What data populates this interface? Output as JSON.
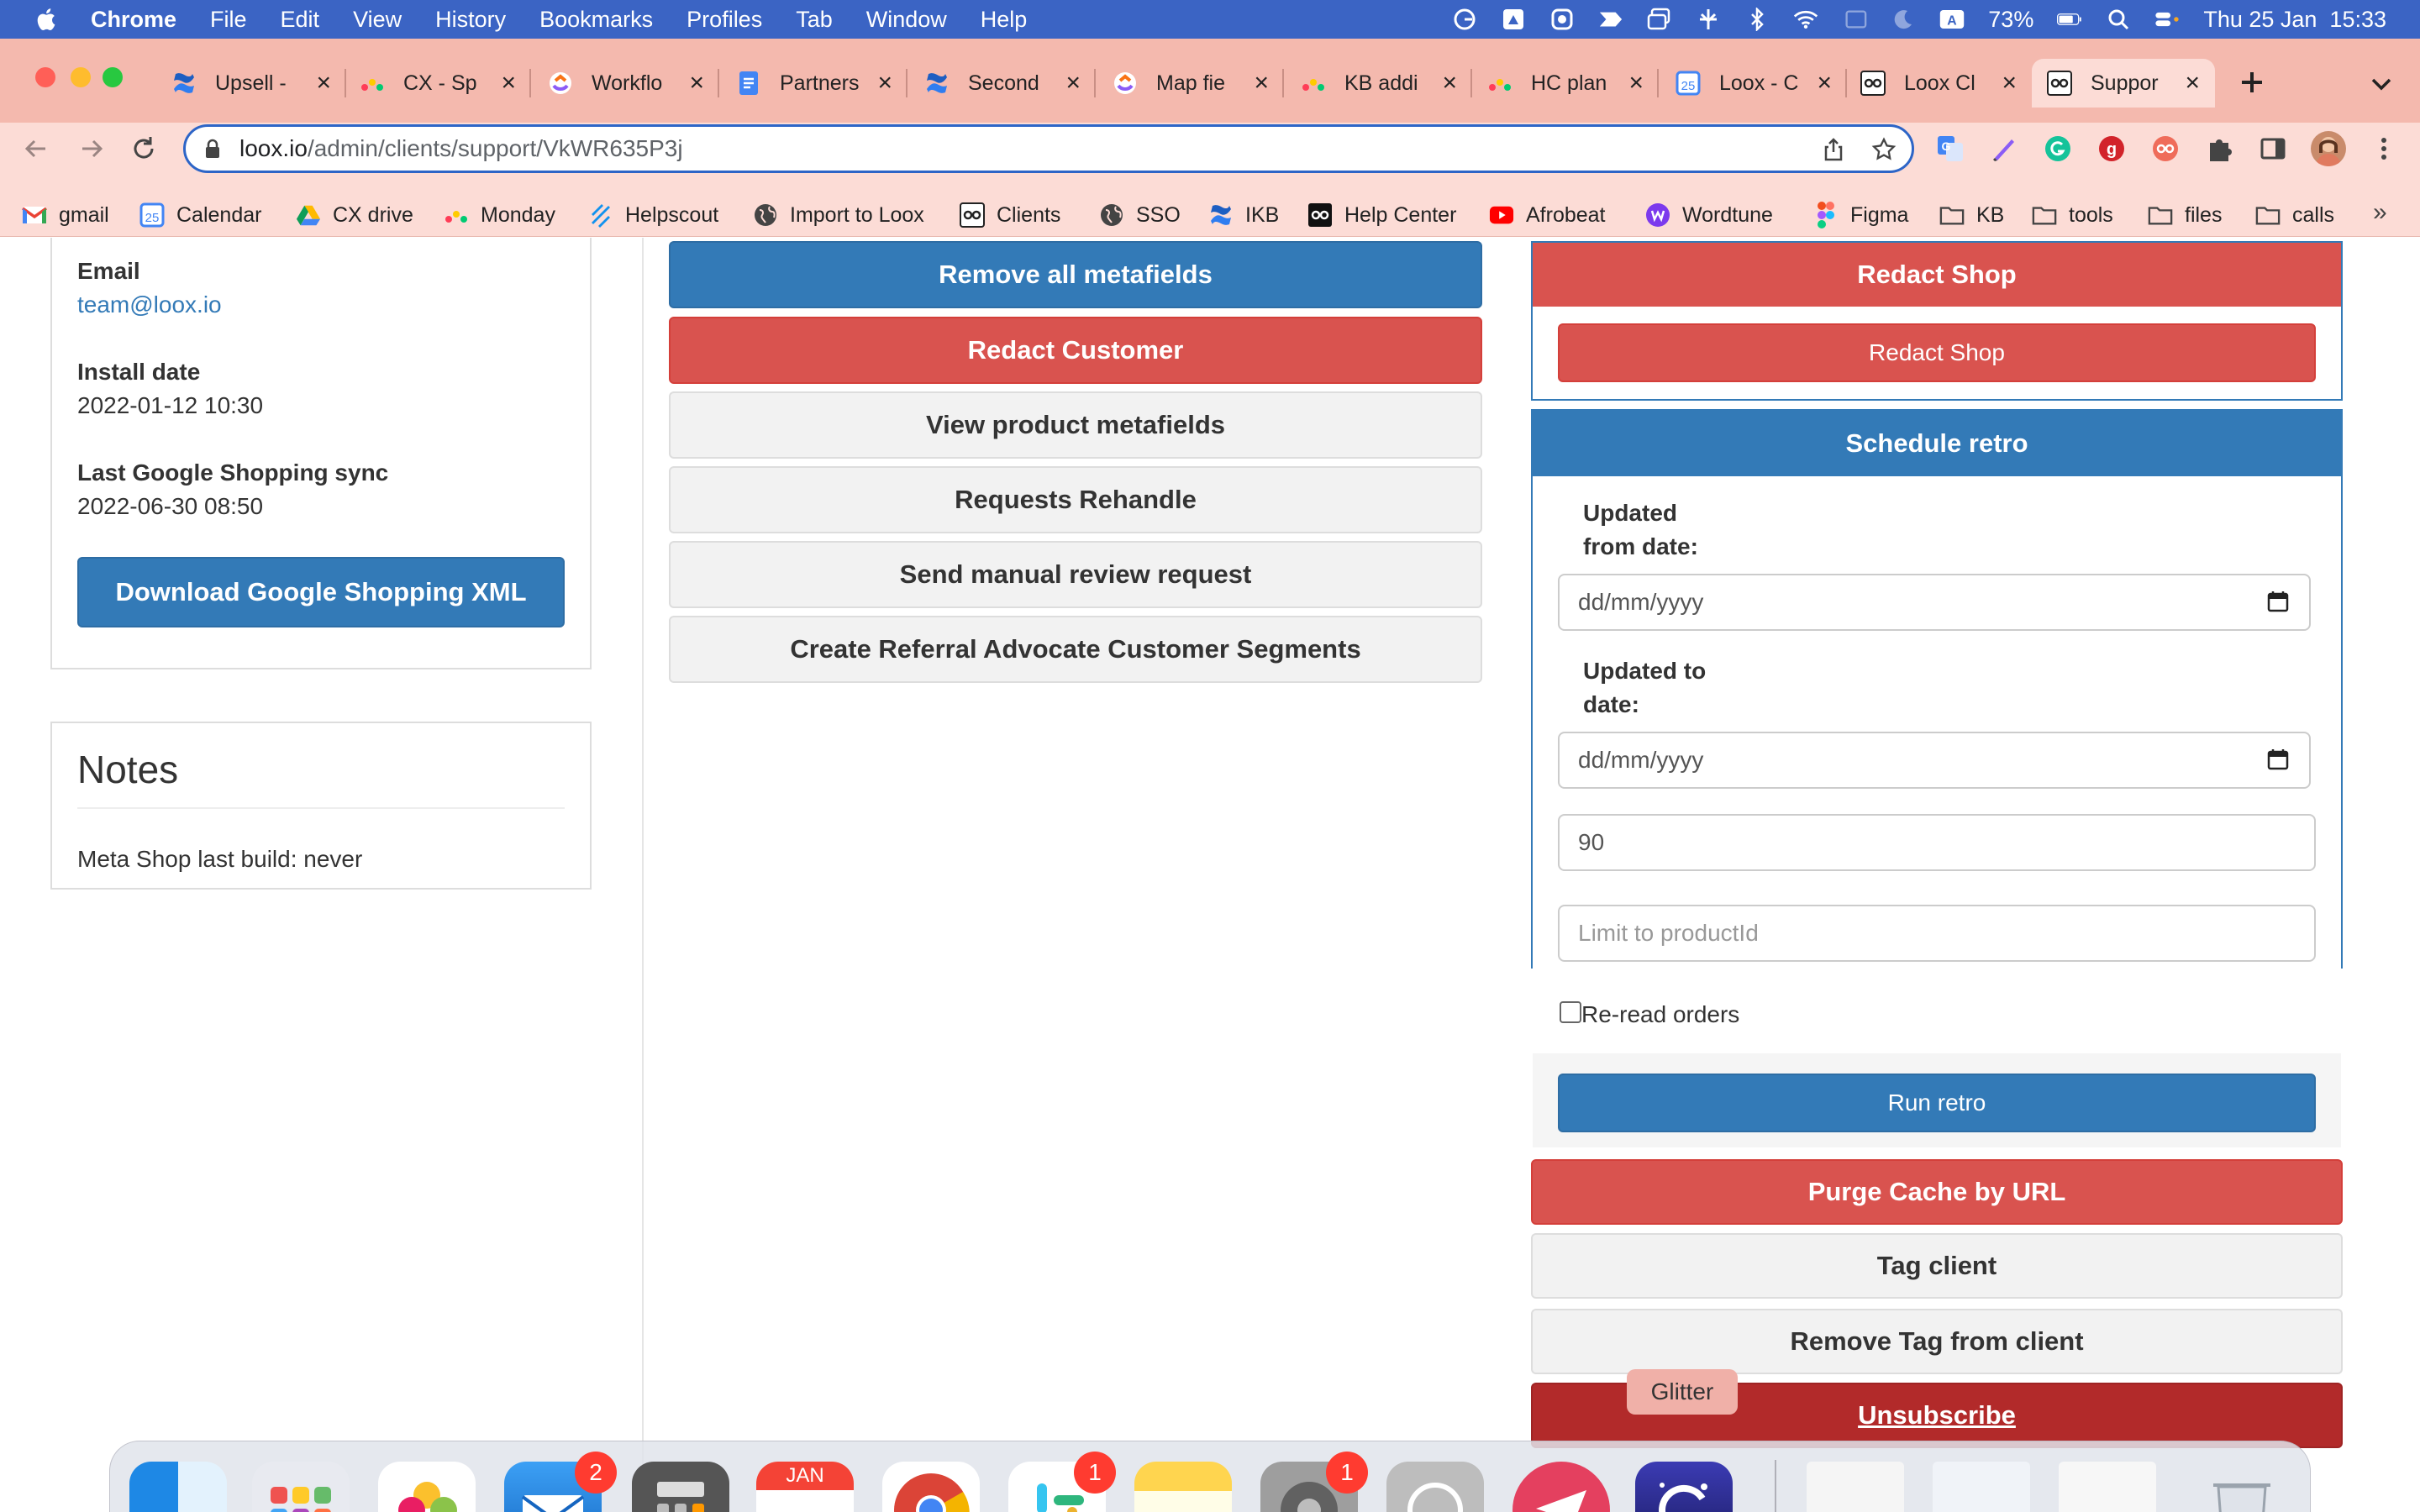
{
  "menubar": {
    "app": "Chrome",
    "items": [
      "File",
      "Edit",
      "View",
      "History",
      "Bookmarks",
      "Profiles",
      "Tab",
      "Window",
      "Help"
    ],
    "battery": "73%",
    "clock": "Thu 25 Jan  15:33"
  },
  "tabs": [
    {
      "title": "Upsell -",
      "icon": "confluence-icon"
    },
    {
      "title": "CX - Sp",
      "icon": "monday-icon"
    },
    {
      "title": "Workflo",
      "icon": "clickup-icon"
    },
    {
      "title": "Partners",
      "icon": "docs-icon"
    },
    {
      "title": "Second",
      "icon": "confluence-icon"
    },
    {
      "title": "Map fie",
      "icon": "clickup-icon"
    },
    {
      "title": "KB addi",
      "icon": "monday-icon"
    },
    {
      "title": "HC plan",
      "icon": "monday-icon"
    },
    {
      "title": "Loox - C",
      "icon": "calendar-icon"
    },
    {
      "title": "Loox Cl",
      "icon": "loox-icon"
    },
    {
      "title": "Suppor",
      "icon": "loox-icon",
      "active": true
    }
  ],
  "address": {
    "host": "loox.io",
    "path": "/admin/clients/support/VkWR635P3j"
  },
  "bookmarks": [
    {
      "label": "gmail",
      "icon": "gmail-icon"
    },
    {
      "label": "Calendar",
      "icon": "calendar-icon"
    },
    {
      "label": "CX drive",
      "icon": "drive-icon"
    },
    {
      "label": "Monday",
      "icon": "monday-icon"
    },
    {
      "label": "Helpscout",
      "icon": "helpscout-icon"
    },
    {
      "label": "Import to Loox",
      "icon": "globe-icon"
    },
    {
      "label": "Clients",
      "icon": "loox-icon"
    },
    {
      "label": "SSO",
      "icon": "globe-icon"
    },
    {
      "label": "IKB",
      "icon": "confluence-icon"
    },
    {
      "label": "Help Center",
      "icon": "loox-icon"
    },
    {
      "label": "Afrobeat",
      "icon": "youtube-icon"
    },
    {
      "label": "Wordtune",
      "icon": "wordtune-icon"
    },
    {
      "label": "Figma",
      "icon": "figma-icon"
    },
    {
      "label": "KB",
      "icon": "folder-icon"
    },
    {
      "label": "tools",
      "icon": "folder-icon"
    },
    {
      "label": "files",
      "icon": "folder-icon"
    },
    {
      "label": "calls",
      "icon": "folder-icon"
    }
  ],
  "info": {
    "email_label": "Email",
    "email_value": "team@loox.io",
    "install_label": "Install date",
    "install_value": "2022-01-12 10:30",
    "sync_label": "Last Google Shopping sync",
    "sync_value": "2022-06-30 08:50",
    "download_button": "Download Google Shopping XML"
  },
  "notes": {
    "title": "Notes",
    "text": "Meta Shop last build: never"
  },
  "actions": {
    "remove_metafields": "Remove all metafields",
    "redact_customer": "Redact Customer",
    "view_metafields": "View product metafields",
    "rehandle": "Requests Rehandle",
    "manual_review": "Send manual review request",
    "referral_segments": "Create Referral Advocate Customer Segments"
  },
  "redact_shop": {
    "heading": "Redact Shop",
    "button": "Redact Shop"
  },
  "retro": {
    "heading": "Schedule retro",
    "from_label": "Updated from date:",
    "from_placeholder": "dd/mm/yyyy",
    "to_label": "Updated to date:",
    "to_placeholder": "dd/mm/yyyy",
    "days_value": "90",
    "product_placeholder": "Limit to productId",
    "reread_label": "Re-read orders",
    "run_button": "Run retro"
  },
  "more_actions": {
    "purge_cache": "Purge Cache by URL",
    "tag_client": "Tag client",
    "remove_tag": "Remove Tag from client",
    "unsubscribe": "Unsubscribe"
  },
  "dock": {
    "tooltip": "Glitter",
    "calendar_month": "JAN",
    "mail_badge": "2",
    "slack_badge": "1",
    "settings_badge": "1"
  }
}
